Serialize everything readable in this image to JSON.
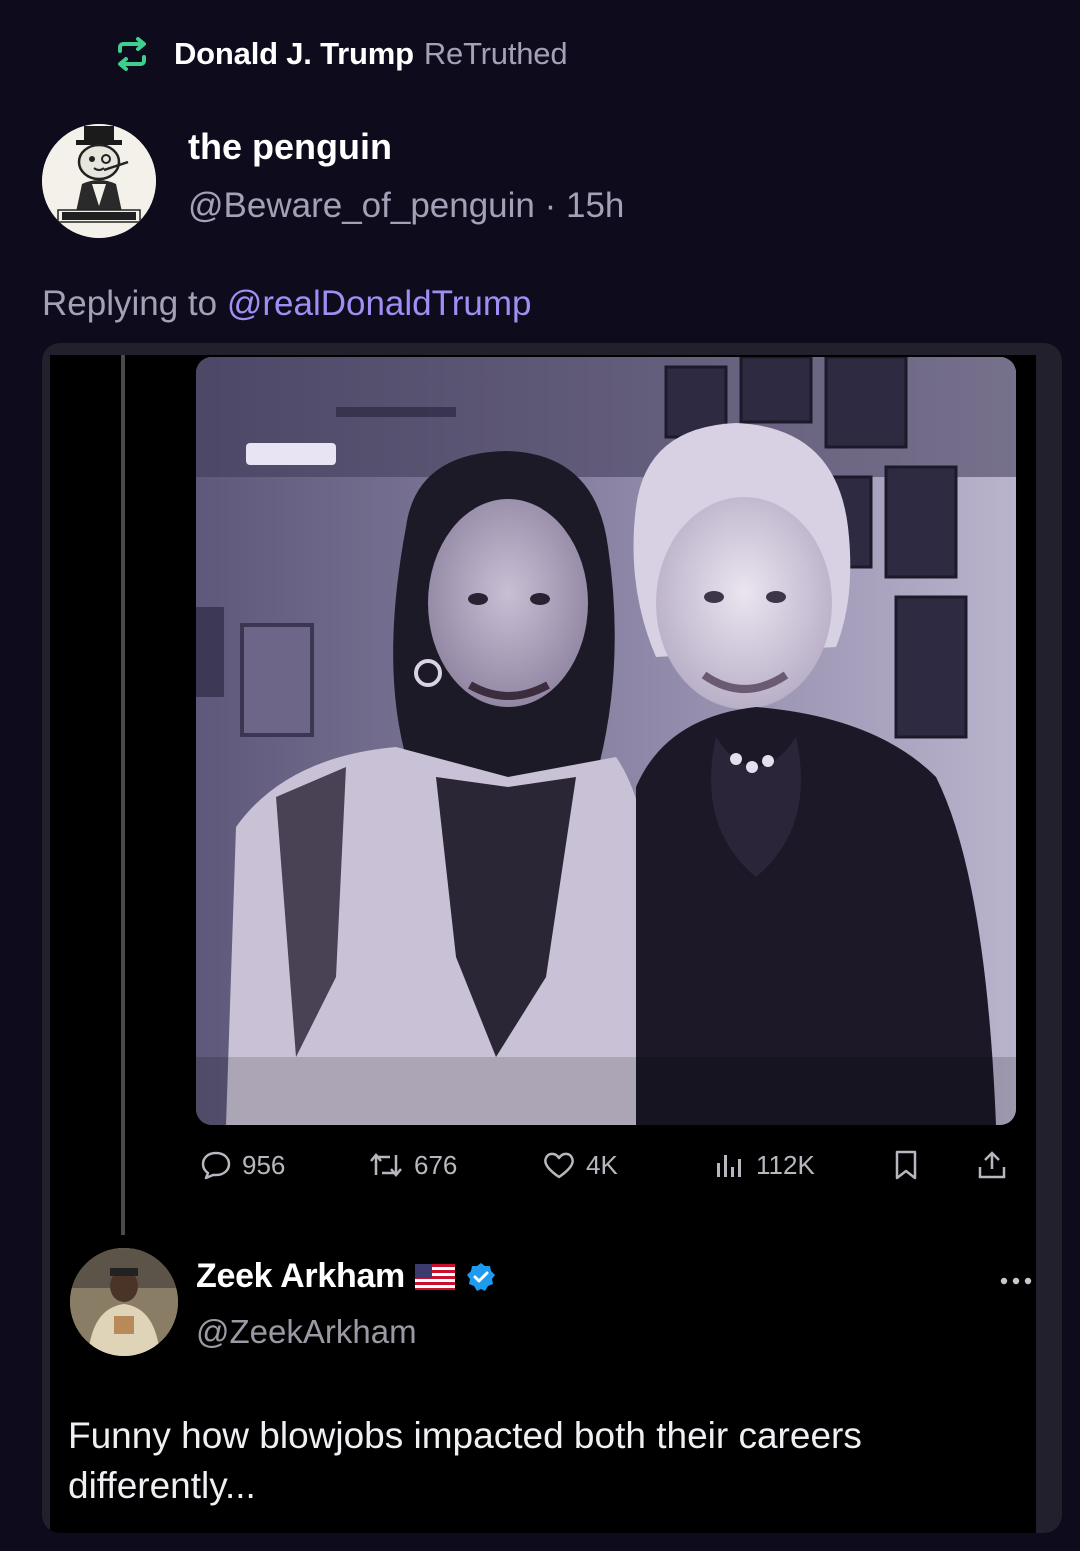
{
  "retruth": {
    "icon": "retruth-icon",
    "name": "Donald J. Trump",
    "verb": "ReTruthed"
  },
  "author": {
    "avatar": "penguin-avatar",
    "name": "the penguin",
    "meta": "@Beware_of_penguin · 15h"
  },
  "reply_to": {
    "prefix": "Replying to ",
    "handle": "@realDonaldTrump"
  },
  "embedded_post": {
    "photo_description_icon": "photo-two-women",
    "actions": [
      {
        "icon": "comment-icon",
        "count": "956"
      },
      {
        "icon": "repost-icon",
        "count": "676"
      },
      {
        "icon": "heart-icon",
        "count": "4K"
      },
      {
        "icon": "views-icon",
        "count": "112K"
      },
      {
        "icon": "bookmark-icon"
      },
      {
        "icon": "share-icon"
      }
    ],
    "reply": {
      "name": "Zeek Arkham",
      "handle": "@ZeekArkham",
      "text": "Funny how blowjobs impacted both their careers differently..."
    }
  },
  "colors": {
    "background": "#0d0b1c",
    "muted_text": "#a3a1b5",
    "link": "#9d8ff4",
    "retruth_green": "#3ecf8e",
    "verified_blue": "#1d9bf0"
  }
}
